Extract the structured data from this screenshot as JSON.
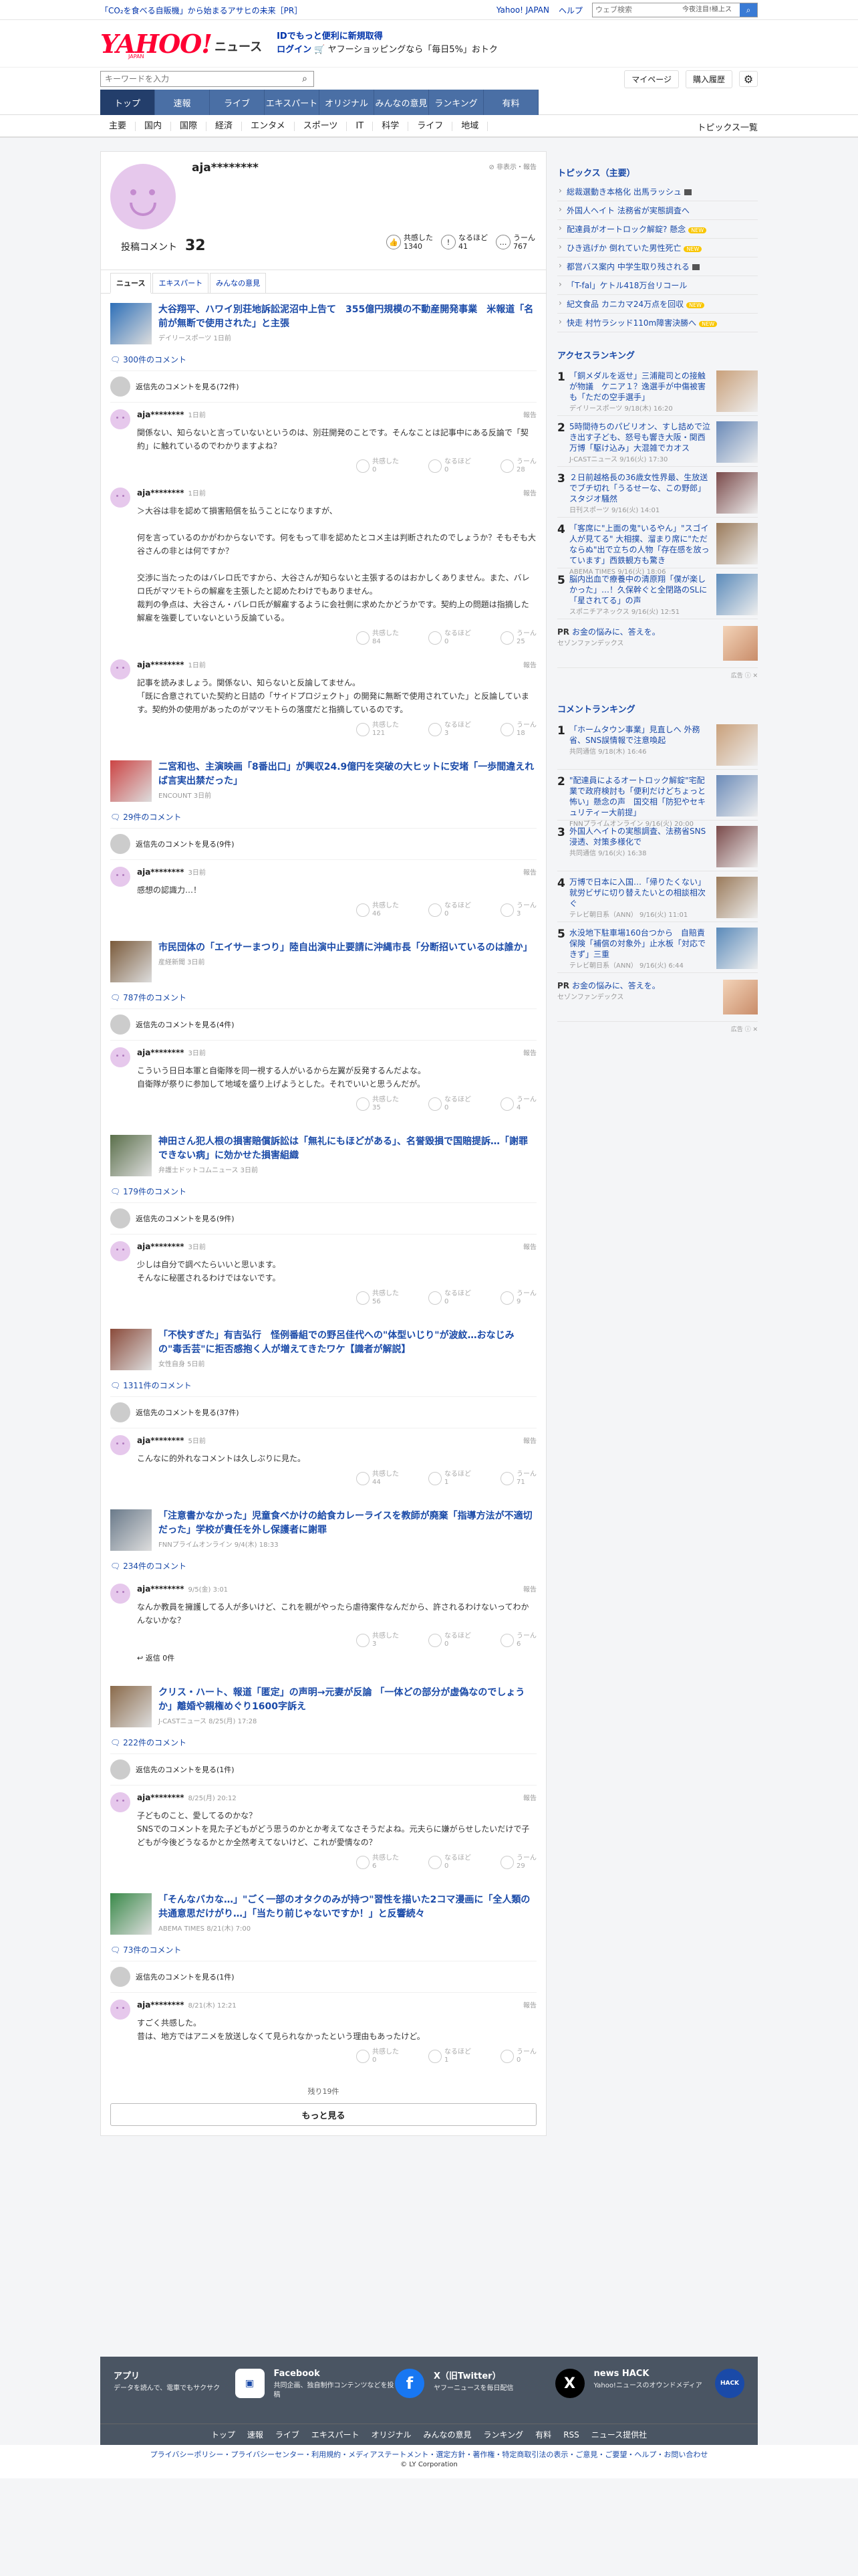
{
  "topbar": {
    "pr": "「CO₂を食べる自販機」から始まるアサヒの未来［PR］",
    "links": [
      "Yahoo! JAPAN",
      "ヘルプ"
    ],
    "search_placeholder": "ウェブ検索",
    "search_value": "今夜注目!極上ス"
  },
  "logo": {
    "main": "YAHOO!",
    "news": "ニュース",
    "sub": "JAPAN"
  },
  "promo": {
    "line1": "IDでもっと便利に新規取得",
    "line2": "ログイン",
    "line2b": "ヤフーショッピングなら「毎日5%」おトク"
  },
  "search": {
    "placeholder": "キーワードを入力"
  },
  "user_links": [
    "マイページ",
    "購入履歴"
  ],
  "mainnav": [
    "トップ",
    "速報",
    "ライブ",
    "エキスパート",
    "オリジナル",
    "みんなの意見",
    "ランキング",
    "有料"
  ],
  "subnav": {
    "cats": [
      "主要",
      "国内",
      "国際",
      "経済",
      "エンタメ",
      "スポーツ",
      "IT",
      "科学",
      "ライフ",
      "地域"
    ],
    "all": "トピックス一覧"
  },
  "profile": {
    "name": "aja********",
    "report": "非表示・報告",
    "post_label": "投稿コメント",
    "post_count": "32",
    "reacts": [
      {
        "label": "共感した",
        "value": "1340",
        "icon": "👍"
      },
      {
        "label": "なるほど",
        "value": "41",
        "icon": "!"
      },
      {
        "label": "うーん",
        "value": "767",
        "icon": "…"
      }
    ]
  },
  "tabs": [
    "ニュース",
    "エキスパート",
    "みんなの意見"
  ],
  "articles": [
    {
      "title": "大谷翔平、ハワイ別荘地訴訟泥沼中上告て　355億円規模の不動産開発事業　米報道「名前が無断で使用された」と主張",
      "src": "デイリースポーツ 1日前",
      "count": "300件のコメント",
      "others": "返信先のコメントを見る(72件)",
      "comments": [
        {
          "user": "aja********",
          "date": "1日前",
          "text": "関係ない、知らないと言っていないというのは、別荘開発のことです。そんなことは記事中にある反論で「契約」に触れているのでわかりますよね？",
          "r": [
            "0",
            "0",
            "28"
          ]
        },
        {
          "user": "aja********",
          "date": "1日前",
          "text": "＞大谷は非を認めて損害賠償を払うことになりますが、\n\n何を言っているのかがわからないです。何をもって非を認めたとコメ主は判断されたのでしょうか？そもそも大谷さんの非とは何ですか？\n\n交渉に当たったのはバレロ氏ですから、大谷さんが知らないと主張するのはおかしくありません。また、バレロ氏がマツモトらの解雇を主張したと認めたわけでもありません。\n裁判の争点は、大谷さん・バレロ氏が解雇するように会社側に求めたかどうかです。契約上の問題は指摘した解雇を強要していないという反論ている。",
          "r": [
            "84",
            "0",
            "25"
          ]
        },
        {
          "user": "aja********",
          "date": "1日前",
          "text": "記事を読みましょう。関係ない、知らないと反論してません。\n「既に合意されていた契約と日詰の「サイドプロジェクト」の開発に無断で使用されていた」と反論しています。契約外の使用があったのがマツモトらの落度だと指摘しているのです。",
          "r": [
            "121",
            "3",
            "18"
          ]
        }
      ]
    },
    {
      "title": "二宮和也、主演映画「8番出口」が興収24.9億円を突破の大ヒットに安堵「一歩間違えれば言実出禁だった」",
      "src": "ENCOUNT 3日前",
      "count": "29件のコメント",
      "others": "返信先のコメントを見る(9件)",
      "comments": [
        {
          "user": "aja********",
          "date": "3日前",
          "text": "感想の認識力…！",
          "r": [
            "46",
            "0",
            "3"
          ]
        }
      ]
    },
    {
      "title": "市民団体の「エイサーまつり」陸自出演中止要請に沖縄市長「分断招いているのは誰か」",
      "src": "産経新聞 3日前",
      "count": "787件のコメント",
      "others": "返信先のコメントを見る(4件)",
      "comments": [
        {
          "user": "aja********",
          "date": "3日前",
          "text": "こういう日日本軍と自衛隊を同一視する人がいるから左翼が反発するんだよな。\n自衛隊が祭りに参加して地域を盛り上げようとした。それでいいと思うんだが。",
          "r": [
            "35",
            "0",
            "4"
          ]
        }
      ]
    },
    {
      "title": "神田さん犯人根の損害賠償訴訟は「無礼にもほどがある」、名誉毀損で国賠提訴…「謝罪できない病」に効かせた損害組織",
      "src": "弁護士ドットコムニュース 3日前",
      "count": "179件のコメント",
      "others": "返信先のコメントを見る(9件)",
      "comments": [
        {
          "user": "aja********",
          "date": "3日前",
          "text": "少しは自分で調べたらいいと思います。\nそんなに秘匿されるわけではないです。",
          "r": [
            "56",
            "0",
            "9"
          ]
        }
      ]
    },
    {
      "title": "「不快すぎた」有吉弘行　怪例番組での野呂佳代への\"体型いじり\"が波紋…おなじみの\"毒舌芸\"に拒否感抱く人が増えてきたワケ【識者が解説】",
      "src": "女性自身 5日前",
      "count": "1311件のコメント",
      "others": "返信先のコメントを見る(37件)",
      "comments": [
        {
          "user": "aja********",
          "date": "5日前",
          "text": "こんなに的外れなコメントは久しぶりに見た。",
          "r": [
            "44",
            "1",
            "71"
          ]
        }
      ]
    },
    {
      "title": "「注意書かなかった」児童食べかけの給食カレーライスを教師が廃棄「指導方法が不適切だった」学校が責任を外し保護者に謝罪",
      "src": "FNNプライムオンライン 9/4(木) 18:33",
      "count": "234件のコメント",
      "others": "",
      "comments": [
        {
          "user": "aja********",
          "date": "9/5(金) 3:01",
          "text": "なんか教員を擁護してる人が多いけど、これを親がやったら虐待案件なんだから、許されるわけないってわかんないかな？",
          "r": [
            "3",
            "0",
            "6"
          ],
          "reply": "返信 0件"
        }
      ]
    },
    {
      "title": "クリス・ハート、報道「匿定」の声明→元妻が反論 「一体どの部分が虚偽なのでしょうか」離婚や親権めぐり1600字訴え",
      "src": "J-CASTニュース 8/25(月) 17:28",
      "count": "222件のコメント",
      "others": "返信先のコメントを見る(1件)",
      "comments": [
        {
          "user": "aja********",
          "date": "8/25(月) 20:12",
          "text": "子どものこと、愛してるのかな？\nSNSでのコメントを見た子どもがどう思うのかとか考えてなさそうだよね。元夫らに嫌がらせしたいだけで子どもが今後どうなるかとか全然考えてないけど、これが愛情なの？",
          "r": [
            "6",
            "0",
            "29"
          ]
        }
      ]
    },
    {
      "title": "「そんなバカな…」\"ごく一部のオタクのみが持つ\"習性を描いた2コマ漫画に「全人類の共通意思だけがり…」「当たり前じゃないですか！」と反響続々",
      "src": "ABEMA TIMES 8/21(木) 7:00",
      "count": "73件のコメント",
      "others": "返信先のコメントを見る(1件)",
      "comments": [
        {
          "user": "aja********",
          "date": "8/21(木) 12:21",
          "text": "すごく共感した。\n昔は、地方ではアニメを放送しなくて見られなかったという理由もあったけど。",
          "r": [
            "0",
            "1",
            "0"
          ]
        }
      ]
    }
  ],
  "reaction_labels": [
    "共感した",
    "なるほど",
    "うーん"
  ],
  "report": "報告",
  "remaining": "残り19件",
  "more_button": "もっと見る",
  "sidebar": {
    "topics_title": "トピックス（主要）",
    "topics": [
      {
        "t": "総裁選動き本格化 出馬ラッシュ",
        "b": "box"
      },
      {
        "t": "外国人ヘイト 法務省が実態調査へ",
        "b": ""
      },
      {
        "t": "配達員がオートロック解錠? 懸念",
        "b": "new"
      },
      {
        "t": "ひき逃げか 倒れていた男性死亡",
        "b": "new"
      },
      {
        "t": "都営バス案内 中学生取り残される",
        "b": "box"
      },
      {
        "t": "「T-fal」ケトル418万台リコール",
        "b": ""
      },
      {
        "t": "紀文食品 カニカマ24万点を回収",
        "b": "new"
      },
      {
        "t": "快走 村竹ラシッド110m障害決勝へ",
        "b": "new"
      }
    ],
    "access_title": "アクセスランキング",
    "access": [
      {
        "n": "1",
        "t": "「銅メダルを返せ」三浦龍司との接触が物議　ケニア１？逸選手が中傷被害も「ただの空手選手」",
        "s": "デイリースポーツ 9/18(木) 16:20"
      },
      {
        "n": "2",
        "t": "5時間待ちのパビリオン、すし詰めで泣き出す子ども、怒号も響き大阪・関西万博「駆け込み」大混雑でカオス",
        "s": "J-CASTニュース 9/16(火) 17:30"
      },
      {
        "n": "3",
        "t": "２日前越格長の36歳女性界最、生放送でブチ切れ「うるせーな、この野郎」スタジオ騒然",
        "s": "日刊スポーツ 9/16(火) 14:01"
      },
      {
        "n": "4",
        "t": "「客席に\"上面の鬼\"いるやん」\"スゴイ人が見てる\" 大相撲、溜まり席に\"ただならぬ\"出で立ちの人物「存在感を放っています」西鉄観方も驚き",
        "s": "ABEMA TIMES 9/16(火) 18:06"
      },
      {
        "n": "5",
        "t": "脳内出血で療養中の清原翔「僕が楽しかった」…！久保幹ぐと全閉路のSLに「星されてる」の声",
        "s": "スポニチアネックス 9/16(火) 12:51"
      }
    ],
    "pr1": {
      "tag": "PR",
      "t": "お金の悩みに、答えを。",
      "s": "セゾンファンデックス"
    },
    "ad_label": "広告",
    "comment_title": "コメントランキング",
    "crank": [
      {
        "n": "1",
        "t": "「ホームタウン事業」見直しへ 外務省、SNS誤情報で注意喚起",
        "s": "共同通信 9/18(木) 16:46"
      },
      {
        "n": "2",
        "t": "\"配達員によるオートロック解錠\"宅配業で政府検討も「便利だけどちょっと怖い」懸念の声　国交相「防犯やセキュリティー大前提」",
        "s": "FNNプライムオンライン 9/16(火) 20:00"
      },
      {
        "n": "3",
        "t": "外国人ヘイトの実態調査、法務省SNS浸透、対策多様化で",
        "s": "共同通信 9/16(火) 16:38"
      },
      {
        "n": "4",
        "t": "万博で日本に入国…「帰りたくない」就労ビザに切り替えたいとの相談相次ぐ",
        "s": "テレビ朝日系（ANN） 9/16(火) 11:01"
      },
      {
        "n": "5",
        "t": "水没地下駐車場160台つから　自賠責保険「補償の対象外」止水板「対応できず」三重",
        "s": "テレビ朝日系（ANN） 9/16(火) 6:44"
      }
    ],
    "pr2": {
      "tag": "PR",
      "t": "お金の悩みに、答えを。",
      "s": "セゾンファンデックス"
    }
  },
  "footer": {
    "blocks": [
      {
        "t": "アプリ",
        "d": "データを読んで、電車でもサクサク"
      },
      {
        "t": "Facebook",
        "d": "共同企画、独自制作コンテンツなどを投稿"
      },
      {
        "t": "X（旧Twitter）",
        "d": "ヤフーニュースを毎日配信"
      },
      {
        "t": "news HACK",
        "d": "Yahoo!ニュースのオウンドメディア"
      }
    ],
    "nav": [
      "トップ",
      "速報",
      "ライブ",
      "エキスパート",
      "オリジナル",
      "みんなの意見",
      "ランキング",
      "有料",
      "RSS",
      "ニュース提供社"
    ],
    "legal": "プライバシーポリシー・プライバシーセンター・利用規約・メディアステートメント・選定方針・著作権・特定商取引法の表示・ご意見・ご要望・ヘルプ・お問い合わせ",
    "copyright": "© LY Corporation"
  },
  "colors": {
    "nav_active": "#233e6b",
    "nav": "#4a6fa5",
    "link": "#1a4aa8",
    "brand": "#ff0033"
  }
}
